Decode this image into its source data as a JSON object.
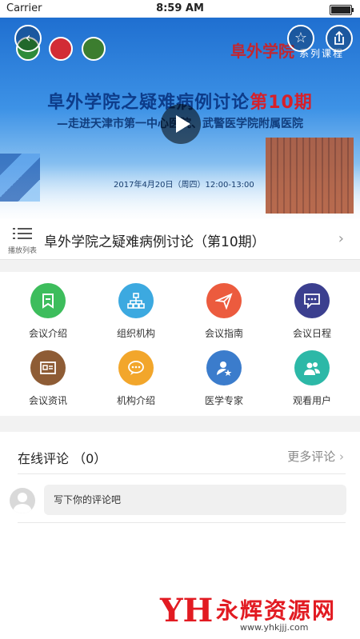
{
  "status_bar": {
    "carrier": "Carrier",
    "time": "8:59 AM"
  },
  "banner": {
    "brand": "阜外学院",
    "series": "系列课程",
    "title_main": "阜外学院之疑难病例讨论",
    "title_highlight": "第10期",
    "subtitle": "—走进天津市第一中心医院、武警医学院附属医院",
    "date_line": "2017年4月20日（周四）12:00-13:00"
  },
  "video": {
    "playlist_label": "播放列表",
    "title": "阜外学院之疑难病例讨论（第10期）"
  },
  "menu": [
    {
      "label": "会议介绍",
      "icon": "bookmark-icon",
      "color": "#3dbd5c"
    },
    {
      "label": "组织机构",
      "icon": "org-chart-icon",
      "color": "#3ca9e0"
    },
    {
      "label": "会议指南",
      "icon": "paper-plane-icon",
      "color": "#ec5b3e"
    },
    {
      "label": "会议日程",
      "icon": "chat-icon",
      "color": "#3b3f8f"
    },
    {
      "label": "会议资讯",
      "icon": "id-card-icon",
      "color": "#8e5c35"
    },
    {
      "label": "机构介绍",
      "icon": "message-icon",
      "color": "#f2a62b"
    },
    {
      "label": "医学专家",
      "icon": "expert-icon",
      "color": "#3b7ccc"
    },
    {
      "label": "观看用户",
      "icon": "users-icon",
      "color": "#2cb8a7"
    }
  ],
  "comments": {
    "heading": "在线评论",
    "count": "（0）",
    "more": "更多评论",
    "placeholder": "写下你的评论吧"
  },
  "watermark": {
    "name": "永辉资源网",
    "url": "www.yhkjjj.com"
  }
}
